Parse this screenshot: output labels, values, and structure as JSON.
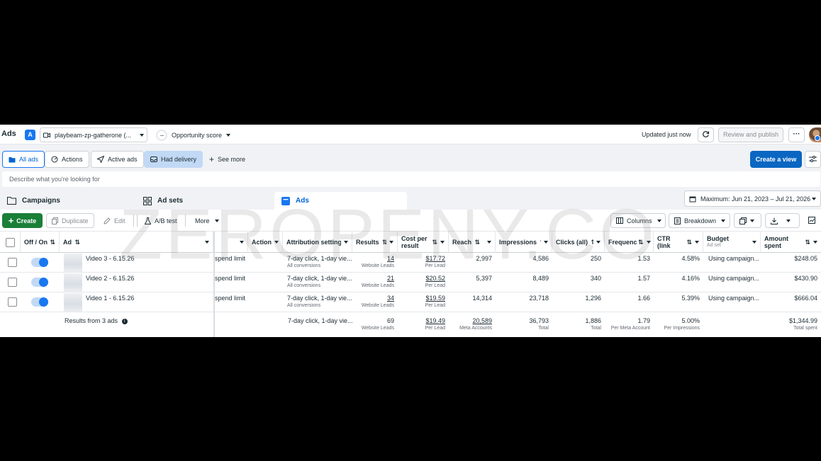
{
  "topbar": {
    "title": "Ads",
    "account_badge": "A",
    "account_name": "playbeam-zp-gatherone (...",
    "opportunity_label": "Opportunity score",
    "updated": "Updated just now",
    "review_label": "Review and publish",
    "more_label": "···"
  },
  "filters": {
    "all_ads": "All ads",
    "actions": "Actions",
    "active_ads": "Active ads",
    "had_delivery": "Had delivery",
    "see_more": "See more",
    "create_view": "Create a view"
  },
  "search": {
    "placeholder": "Describe what you're looking for"
  },
  "levels": {
    "campaigns": "Campaigns",
    "ad_sets": "Ad sets",
    "ads": "Ads",
    "date_range": "Maximum: Jun 21, 2023 – Jul 21, 2026"
  },
  "toolbar": {
    "create": "Create",
    "duplicate": "Duplicate",
    "edit": "Edit",
    "ab_test": "A/B test",
    "more": "More",
    "columns": "Columns",
    "breakdown": "Breakdown"
  },
  "headers": {
    "off_on": "Off / On",
    "ad": "Ad",
    "actions": "Actions",
    "attribution": "Attribution setting",
    "results": "Results",
    "cost_per_result": "Cost per result",
    "reach": "Reach",
    "impressions": "Impressions",
    "clicks": "Clicks (all)",
    "frequency": "Frequency",
    "ctr": "CTR (link click-...",
    "budget": "Budget",
    "budget_sub": "Ad set",
    "amount_spent": "Amount spent"
  },
  "rows": [
    {
      "name": "Video 3 - 6.15.26",
      "bid": "spend limit",
      "attribution": "7-day click, 1-day vie...",
      "attribution_sub": "All conversions",
      "results": "14",
      "results_sub": "Website Leads",
      "cost": "$17.72",
      "cost_sub": "Per Lead",
      "reach": "2,997",
      "impressions": "4,586",
      "clicks": "250",
      "frequency": "1.53",
      "ctr": "4.58%",
      "budget": "Using campaign...",
      "spent": "$248.05"
    },
    {
      "name": "Video 2 - 6.15.26",
      "bid": "spend limit",
      "attribution": "7-day click, 1-day vie...",
      "attribution_sub": "All conversions",
      "results": "21",
      "results_sub": "Website Leads",
      "cost": "$20.52",
      "cost_sub": "Per Lead",
      "reach": "5,397",
      "impressions": "8,489",
      "clicks": "340",
      "frequency": "1.57",
      "ctr": "4.16%",
      "budget": "Using campaign...",
      "spent": "$430.90"
    },
    {
      "name": "Video 1 - 6.15.26",
      "bid": "spend limit",
      "attribution": "7-day click, 1-day vie...",
      "attribution_sub": "All conversions",
      "results": "34",
      "results_sub": "Website Leads",
      "cost": "$19.59",
      "cost_sub": "Per Lead",
      "reach": "14,314",
      "impressions": "23,718",
      "clicks": "1,296",
      "frequency": "1.66",
      "ctr": "5.39%",
      "budget": "Using campaign...",
      "spent": "$666.04"
    }
  ],
  "totals": {
    "label": "Results from 3 ads",
    "attribution": "7-day click, 1-day vie...",
    "results": "69",
    "results_sub": "Website Leads",
    "cost": "$19.49",
    "cost_sub": "Per Lead",
    "reach": "20,589",
    "reach_sub": "Meta Accounts",
    "impressions": "36,793",
    "impressions_sub": "Total",
    "clicks": "1,886",
    "clicks_sub": "Total",
    "frequency": "1.79",
    "frequency_sub": "Per Meta Account",
    "ctr": "5.00%",
    "ctr_sub": "Per Impressions",
    "spent": "$1,344.99",
    "spent_sub": "Total spent"
  },
  "watermark": "ZEROPENY.CO",
  "colors": {
    "primary": "#0a66c2",
    "create_green": "#1a7f37",
    "toggle_on": "#1877f2",
    "selected_filter": "#c2d9f5"
  }
}
